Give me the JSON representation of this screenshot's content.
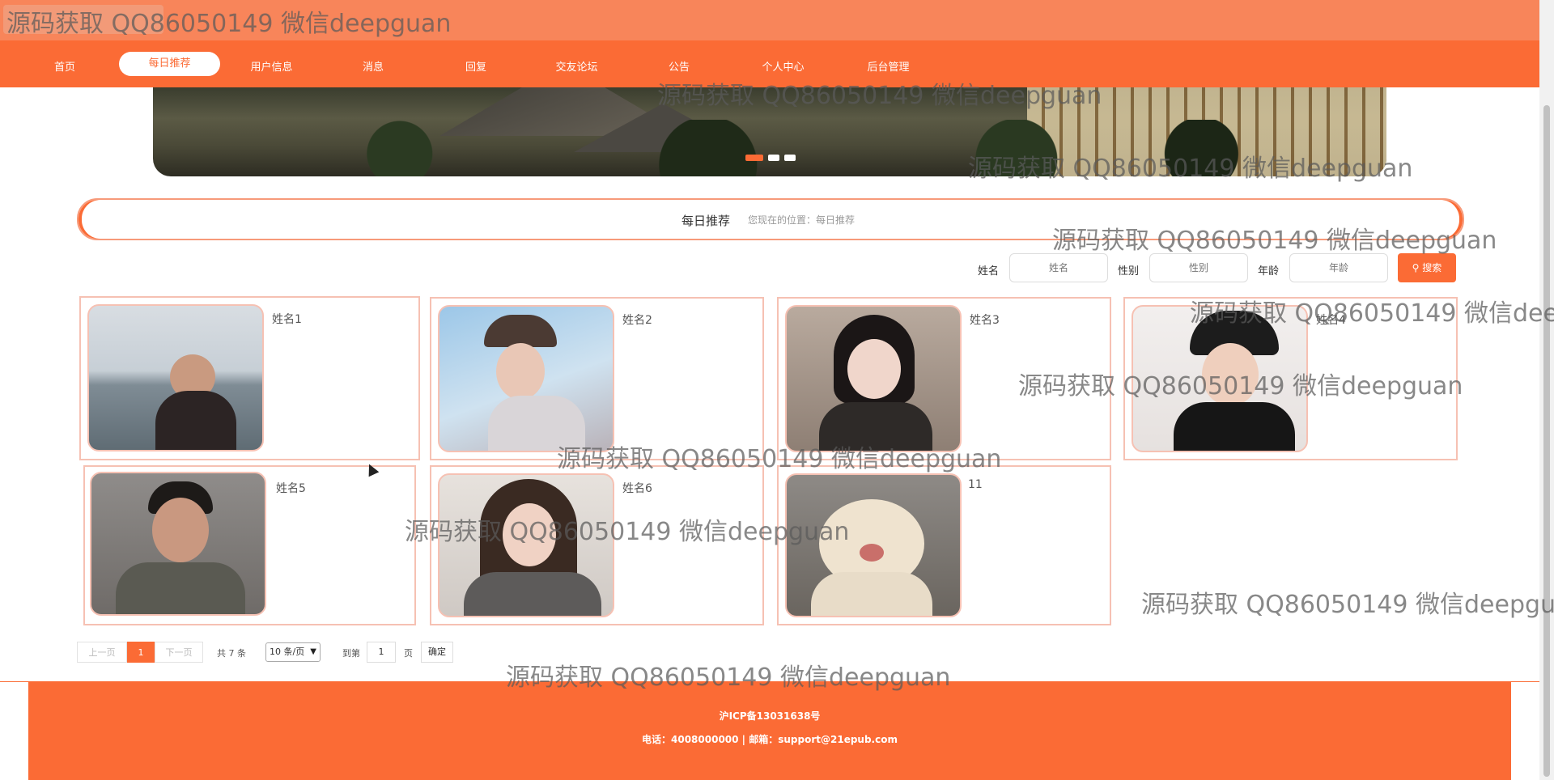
{
  "nav": {
    "items": [
      {
        "label": "首页"
      },
      {
        "label": "每日推荐"
      },
      {
        "label": "用户信息"
      },
      {
        "label": "消息"
      },
      {
        "label": "回复"
      },
      {
        "label": "交友论坛"
      },
      {
        "label": "公告"
      },
      {
        "label": "个人中心"
      },
      {
        "label": "后台管理"
      }
    ],
    "active_index": 1
  },
  "breadcrumb": {
    "title": "每日推荐",
    "location": "您现在的位置：每日推荐"
  },
  "search": {
    "name_label": "姓名",
    "name_placeholder": "姓名",
    "gender_label": "性别",
    "gender_placeholder": "性别",
    "age_label": "年龄",
    "age_placeholder": "年龄",
    "button_label": "搜索"
  },
  "cards": [
    {
      "name": "姓名1"
    },
    {
      "name": "姓名2"
    },
    {
      "name": "姓名3"
    },
    {
      "name": "姓名4"
    },
    {
      "name": "姓名5"
    },
    {
      "name": "姓名6"
    },
    {
      "name": "11"
    }
  ],
  "pager": {
    "prev": "上一页",
    "current": "1",
    "next": "下一页",
    "total": "共 7 条",
    "page_size": "10 条/页",
    "goto": "到第",
    "goto_value": "1",
    "page_unit": "页",
    "confirm": "确定"
  },
  "footer": {
    "icp": "沪ICP备13031638号",
    "contact": "电话：4008000000 | 邮箱：support@21epub.com"
  },
  "watermark": "源码获取 QQ86050149 微信deepguan",
  "colors": {
    "accent": "#fb6b35",
    "topbar": "#f8855a",
    "card_border": "#f6c1b3"
  }
}
